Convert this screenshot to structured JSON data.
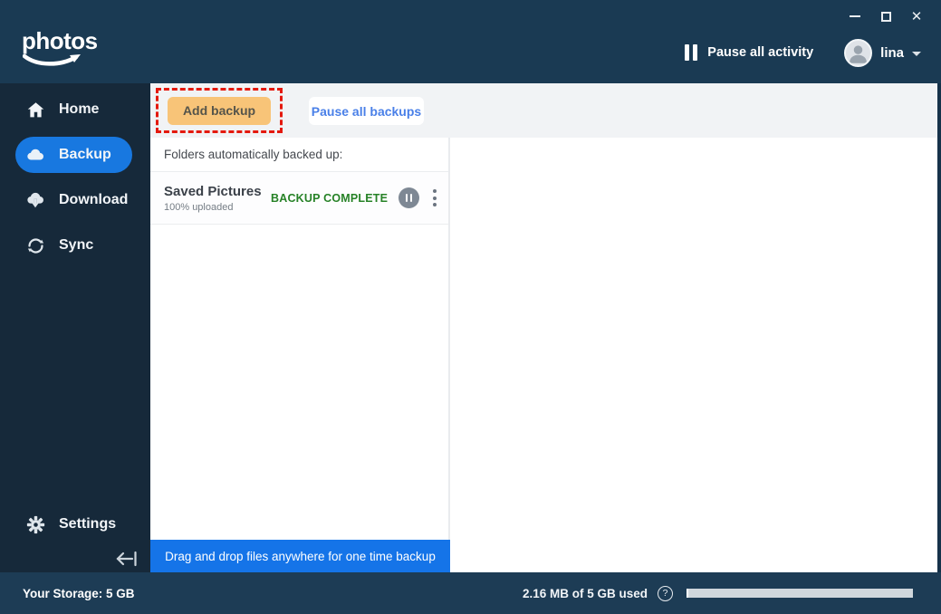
{
  "topbar": {
    "logo": "photos",
    "pause_all_activity": "Pause all activity",
    "username": "lina",
    "window_controls": {
      "close_glyph": "✕",
      "help_note": "minimize and maximize drawn as shapes"
    }
  },
  "sidebar": {
    "items": [
      {
        "label": "Home",
        "icon": "home-icon",
        "active": false
      },
      {
        "label": "Backup",
        "icon": "cloud-icon",
        "active": true
      },
      {
        "label": "Download",
        "icon": "cloud-download-icon",
        "active": false
      },
      {
        "label": "Sync",
        "icon": "sync-icon",
        "active": false
      }
    ],
    "settings_label": "Settings",
    "collapse_icon": "collapse-sidebar-icon"
  },
  "toolbar": {
    "add_backup": "Add backup",
    "pause_all_backups": "Pause all backups"
  },
  "backup_panel": {
    "header": "Folders automatically backed up:",
    "folders": [
      {
        "name": "Saved Pictures",
        "progress": "100% uploaded",
        "status": "BACKUP COMPLETE"
      }
    ],
    "drag_drop_banner": "Drag and drop files anywhere for one time backup"
  },
  "statusbar": {
    "storage_label": "Your Storage: 5 GB",
    "usage": "2.16 MB of 5 GB used",
    "help_glyph": "?"
  },
  "colors": {
    "topbar_bg": "#1a3a53",
    "sidebar_bg": "#16293a",
    "statusbar_bg": "#1d3c55",
    "accent_blue": "#1878e0",
    "banner_blue": "#1574e8",
    "button_orange": "#f8c478",
    "annotation_red": "#e4190e",
    "status_green": "#278227",
    "toolbar_band": "#f1f3f5"
  }
}
